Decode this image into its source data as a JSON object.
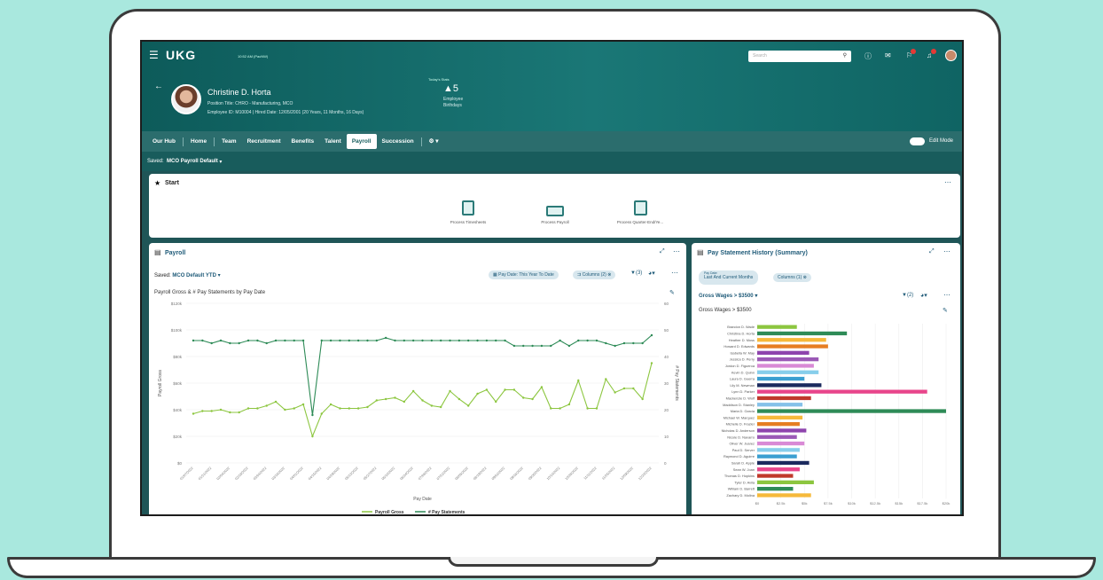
{
  "header": {
    "app": "UKG",
    "time": "10:52 AM (PacNW)",
    "search_placeholder": "Search",
    "today_label": "Today's Stats",
    "stat_value": "5",
    "stat_label1": "Employee",
    "stat_label2": "Birthdays",
    "name": "Christine D. Horta",
    "position": "Position Title: CHRO - Manufacturing, MCO",
    "employee": "Employee ID: M10004  |  Hired Date: 12/05/2001 (20 Years, 11 Months, 16 Days)"
  },
  "nav": {
    "items": [
      "Our Hub",
      "Home",
      "Team",
      "Recruitment",
      "Benefits",
      "Talent",
      "Payroll",
      "Succession"
    ],
    "active": "Payroll",
    "edit_mode": "Edit Mode"
  },
  "saved": {
    "label": "Saved:",
    "value": "MCO Payroll Default"
  },
  "start": {
    "title": "Start",
    "items": [
      "Process Timesheets",
      "Process Payroll",
      "Process Quarter-End/Ye..."
    ]
  },
  "payroll": {
    "title": "Payroll",
    "saved_label": "Saved:",
    "saved_value": "MCO Default YTD",
    "filter_date": "Pay Date: This Year To Date",
    "filter_columns": "Columns (2)",
    "filter_count": "(3)",
    "chart_title": "Payroll Gross & # Pay Statements by Pay Date",
    "ylabel_left": "Payroll Gross",
    "ylabel_right": "# Pay Statements",
    "xlabel": "Pay Date",
    "legend": [
      "Payroll Gross",
      "# Pay Statements"
    ]
  },
  "history": {
    "title": "Pay Statement History (Summary)",
    "pill1_small": "Pay Date:",
    "pill1": "Last And Current Months",
    "pill2": "Columns (1)",
    "filter_label": "Gross Wages > $3500",
    "filter_count": "(2)",
    "chart_title": "Gross Wages > $3500"
  },
  "chart_data": [
    {
      "type": "line",
      "title": "Payroll Gross & # Pay Statements by Pay Date",
      "xlabel": "Pay Date",
      "ylabel": "Payroll Gross",
      "y2label": "# Pay Statements",
      "ylim": [
        0,
        120
      ],
      "y_ticks": [
        "$0",
        "$20k",
        "$40k",
        "$60k",
        "$80k",
        "$100k",
        "$120k"
      ],
      "y2lim": [
        0,
        60
      ],
      "y2_ticks": [
        "0",
        "10",
        "20",
        "30",
        "40",
        "50",
        "60"
      ],
      "series": [
        {
          "name": "Payroll Gross",
          "color": "#8cc63f",
          "values": [
            37,
            39,
            39,
            40,
            38,
            38,
            41,
            41,
            43,
            46,
            40,
            41,
            44,
            20,
            37,
            44,
            41,
            41,
            41,
            42,
            47,
            48,
            49,
            46,
            54,
            47,
            43,
            42,
            54,
            48,
            43,
            52,
            55,
            46,
            55,
            55,
            49,
            48,
            57,
            41,
            41,
            44,
            62,
            41,
            41,
            63,
            53,
            56,
            56,
            48,
            75
          ]
        },
        {
          "name": "# Pay Statements",
          "color": "#2e8b57",
          "values": [
            46,
            46,
            45,
            46,
            45,
            45,
            46,
            46,
            45,
            46,
            46,
            46,
            46,
            18,
            46,
            46,
            46,
            46,
            46,
            46,
            46,
            47,
            46,
            46,
            46,
            46,
            46,
            46,
            46,
            46,
            46,
            46,
            46,
            46,
            46,
            44,
            44,
            44,
            44,
            44,
            46,
            44,
            46,
            46,
            46,
            45,
            44,
            45,
            45,
            45,
            48
          ]
        }
      ]
    },
    {
      "type": "bar",
      "title": "Gross Wages > $3500",
      "x_ticks": [
        "$0",
        "$2.5k",
        "$5k",
        "$7.5k",
        "$10k",
        "$12.5k",
        "$15k",
        "$17.5k",
        "$20k"
      ],
      "xlim": [
        0,
        20
      ],
      "categories": [
        "Brandon D. Wade",
        "Christina D. Horta",
        "Heather D. Moss",
        "Howard D. Edwards",
        "Isabella W. May",
        "Jessica D. Perry",
        "Jordon D. Figueroa",
        "Kevin D. Quinn",
        "Laura D. Guerra",
        "Lily M. Newman",
        "Lynn D. Parker",
        "Mackenzie D. Wolf",
        "Maddison D. Stanley",
        "Maria D. Garcia",
        "Michael W. Marquez",
        "Michelle D. Frazier",
        "Nicholas D. Anderson",
        "Nicole D. Navarro",
        "Oliver W. Juarez",
        "Paul D. Server",
        "Raymond D. Aguirre",
        "Sarah D. Apple",
        "Sean W. Joan",
        "Thomas D. Hopkins",
        "Tyler D. Avila",
        "William D. Barrett",
        "Zachary D. Molina"
      ],
      "values": [
        4.2,
        9.5,
        7.3,
        7.5,
        5.5,
        6.5,
        6.0,
        6.5,
        5.0,
        6.8,
        18.0,
        5.7,
        4.8,
        20.0,
        4.8,
        4.5,
        5.2,
        4.2,
        5.0,
        4.5,
        4.2,
        5.5,
        4.5,
        3.8,
        6.0,
        3.8,
        5.7
      ],
      "colors": [
        "#8cc63f",
        "#2e8b57",
        "#f6b93b",
        "#e67e22",
        "#8e44ad",
        "#9b59b6",
        "#d98ad6",
        "#87ceeb",
        "#3b9fd1",
        "#1b2a5e",
        "#e8458b",
        "#c0392b",
        "#85c1e9",
        "#2e8b57",
        "#f6b93b",
        "#e67e22",
        "#8e44ad",
        "#9b59b6",
        "#d98ad6",
        "#87ceeb",
        "#3b9fd1",
        "#1b2a5e",
        "#e8458b",
        "#c0392b",
        "#8cc63f",
        "#2e8b57",
        "#f6b93b"
      ]
    }
  ]
}
